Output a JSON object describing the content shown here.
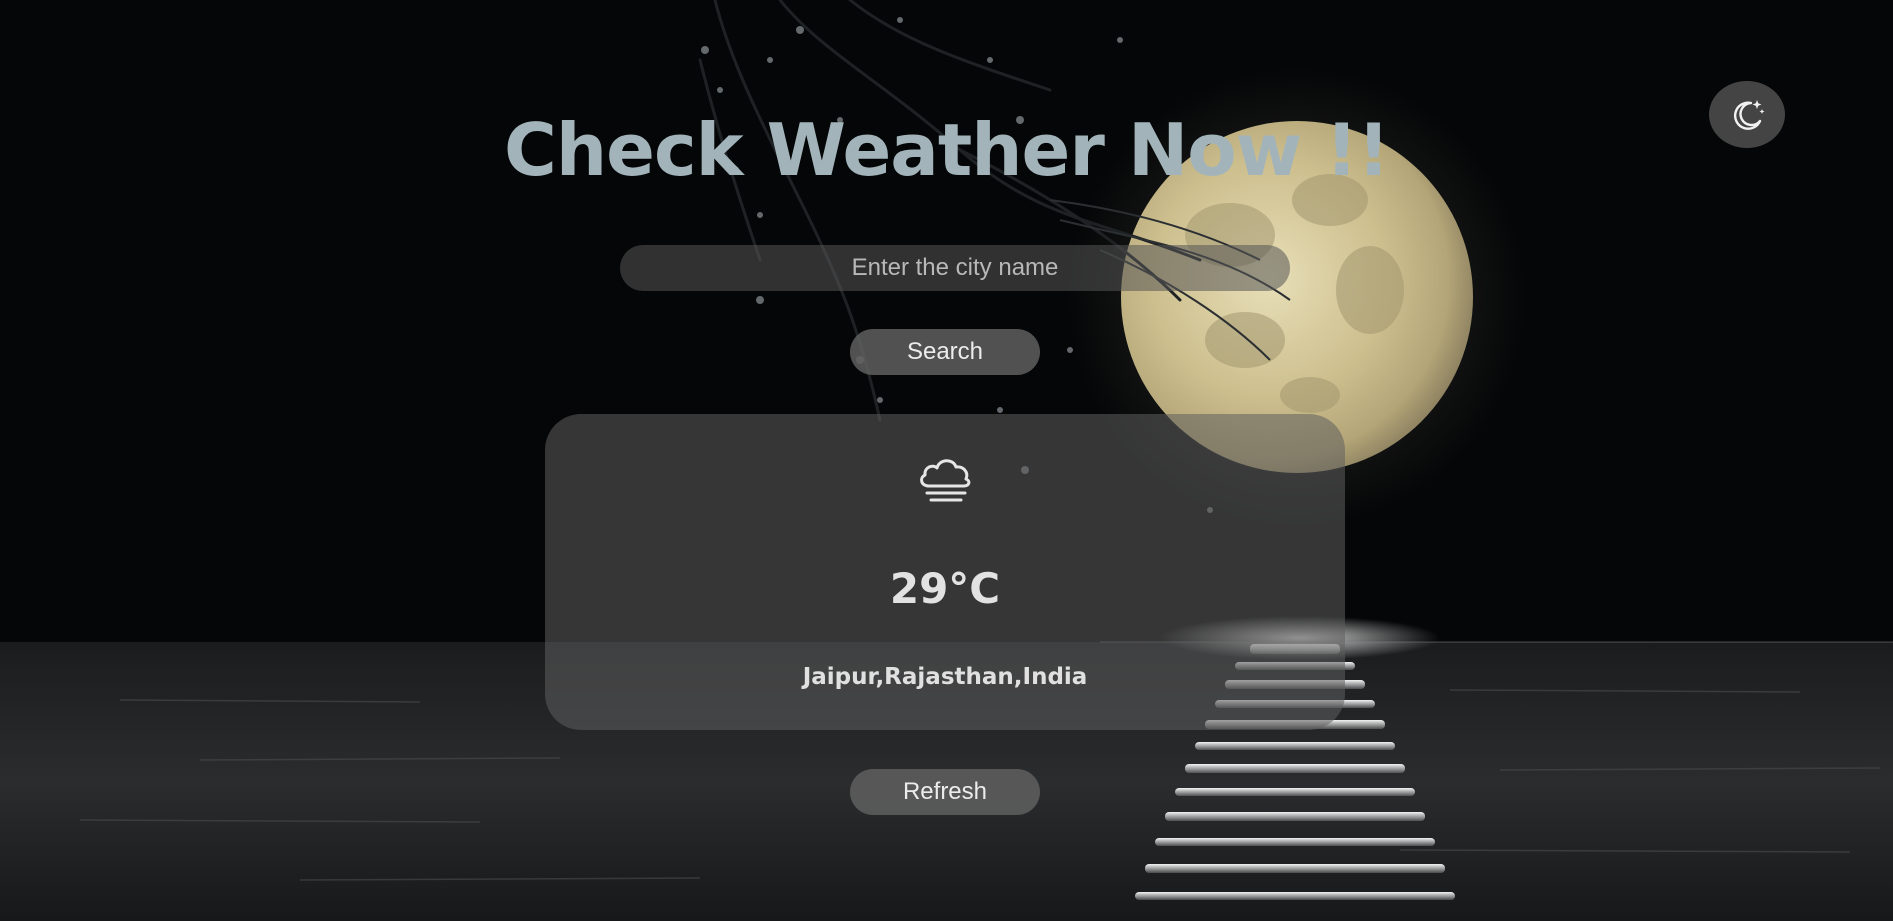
{
  "app": {
    "title": "Check Weather Now !!"
  },
  "theme_toggle": {
    "icon": "moon-stars-icon"
  },
  "search": {
    "placeholder": "Enter the city name",
    "value": "",
    "button_label": "Search"
  },
  "weather": {
    "icon": "cloud-fog-icon",
    "temperature": "29°C",
    "location": "Jaipur,Rajasthan,India"
  },
  "refresh": {
    "button_label": "Refresh"
  },
  "colors": {
    "title": "#a2b4ba",
    "background": "#050607",
    "moon": "#d8cfa6"
  }
}
